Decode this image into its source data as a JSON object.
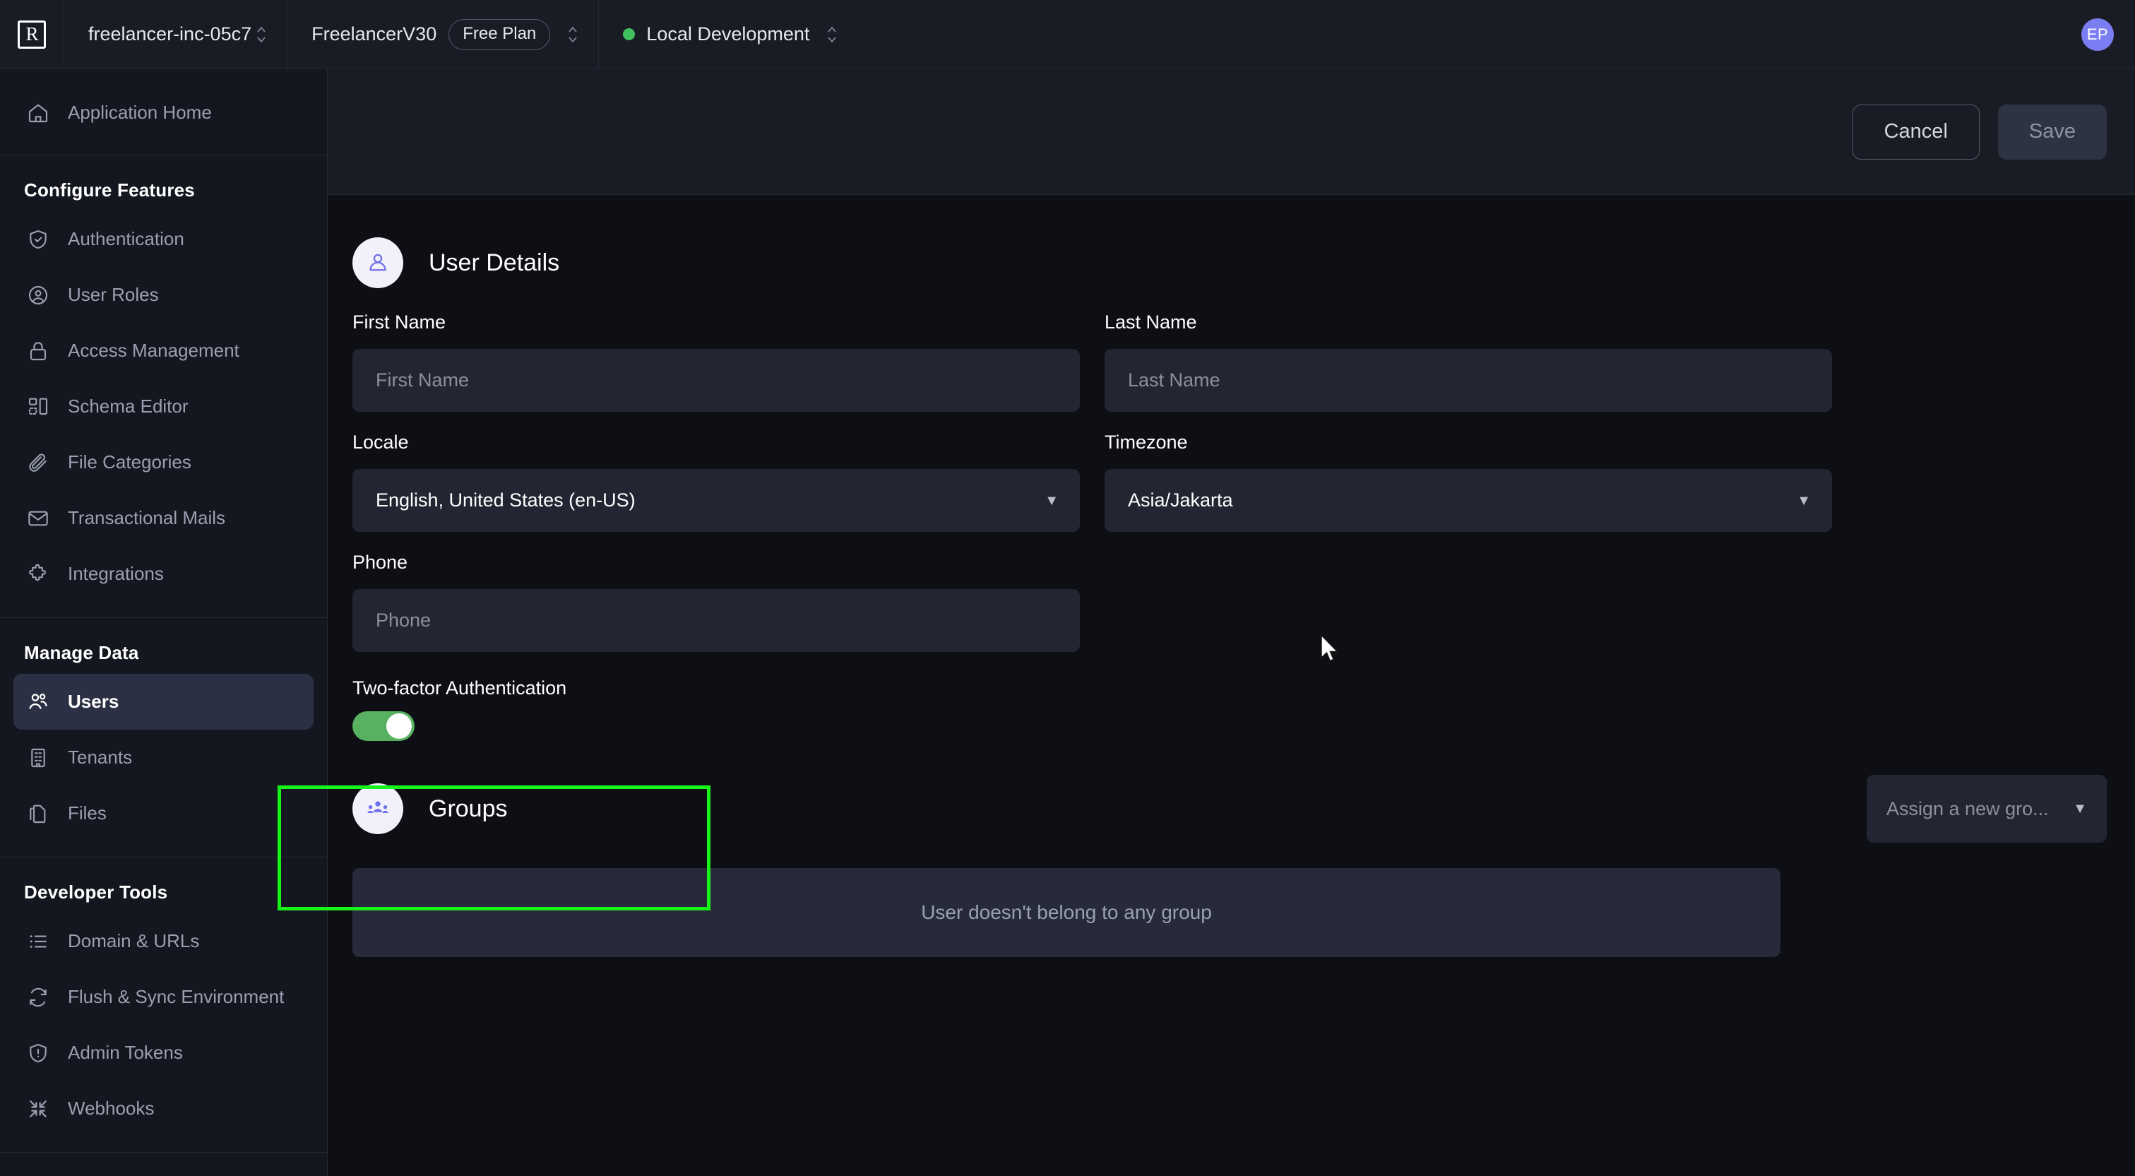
{
  "topbar": {
    "logo_letter": "R",
    "org_name": "freelancer-inc-05c7",
    "project_name": "FreelancerV30",
    "plan_badge": "Free Plan",
    "environment": "Local Development",
    "avatar_initials": "EP"
  },
  "sidebar": {
    "home": {
      "label": "Application Home",
      "icon": "home-icon"
    },
    "sections": [
      {
        "title": "Configure Features",
        "items": [
          {
            "label": "Authentication",
            "icon": "shield-check-icon",
            "active": false
          },
          {
            "label": "User Roles",
            "icon": "user-circle-icon",
            "active": false
          },
          {
            "label": "Access Management",
            "icon": "lock-icon",
            "active": false
          },
          {
            "label": "Schema Editor",
            "icon": "schema-icon",
            "active": false
          },
          {
            "label": "File Categories",
            "icon": "paperclip-icon",
            "active": false
          },
          {
            "label": "Transactional Mails",
            "icon": "mail-icon",
            "active": false
          },
          {
            "label": "Integrations",
            "icon": "puzzle-icon",
            "active": false
          }
        ]
      },
      {
        "title": "Manage Data",
        "items": [
          {
            "label": "Users",
            "icon": "users-icon",
            "active": true
          },
          {
            "label": "Tenants",
            "icon": "building-icon",
            "active": false
          },
          {
            "label": "Files",
            "icon": "files-icon",
            "active": false
          }
        ]
      },
      {
        "title": "Developer Tools",
        "items": [
          {
            "label": "Domain & URLs",
            "icon": "list-icon",
            "active": false
          },
          {
            "label": "Flush & Sync Environment",
            "icon": "sync-icon",
            "active": false
          },
          {
            "label": "Admin Tokens",
            "icon": "shield-alert-icon",
            "active": false
          },
          {
            "label": "Webhooks",
            "icon": "collapse-arrows-icon",
            "active": false
          }
        ]
      }
    ]
  },
  "toolbar": {
    "cancel_label": "Cancel",
    "save_label": "Save"
  },
  "user_details": {
    "section_title": "User Details",
    "section_icon": "user-icon",
    "first_name": {
      "label": "First Name",
      "value": "",
      "placeholder": "First Name"
    },
    "last_name": {
      "label": "Last Name",
      "value": "",
      "placeholder": "Last Name"
    },
    "locale": {
      "label": "Locale",
      "value": "English, United States (en-US)"
    },
    "timezone": {
      "label": "Timezone",
      "value": "Asia/Jakarta"
    },
    "phone": {
      "label": "Phone",
      "value": "",
      "placeholder": "Phone"
    },
    "two_factor": {
      "label": "Two-factor Authentication",
      "enabled": true,
      "state_text": "on"
    }
  },
  "groups": {
    "section_title": "Groups",
    "section_icon": "group-icon",
    "assign_placeholder": "Assign a new gro...",
    "empty_text": "User doesn't belong to any group"
  },
  "colors": {
    "accent_purple": "#7b7df2",
    "toggle_green": "#58b160",
    "status_green": "#3fbf5d",
    "highlight_green": "#18f318",
    "panel_bg": "#232632",
    "sidebar_bg": "#141720",
    "content_bg": "#0d0f14",
    "topbar_bg": "#191c25"
  }
}
